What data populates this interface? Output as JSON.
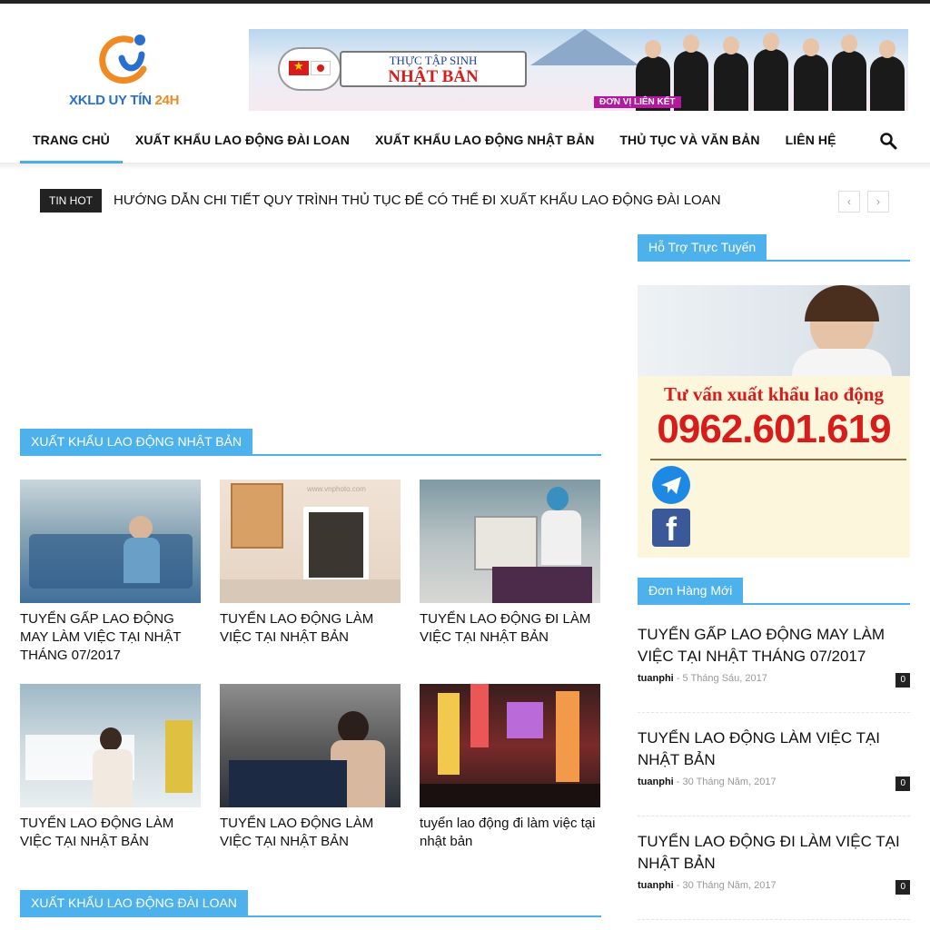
{
  "logo": {
    "text_main": "XKLD UY TÍN",
    "text_accent": "24H"
  },
  "banner": {
    "line1": "THỰC TẬP SINH",
    "line2": "NHẬT BẢN",
    "tag": "ĐƠN VỊ LIÊN KẾT"
  },
  "nav": {
    "items": [
      {
        "label": "TRANG CHỦ"
      },
      {
        "label": "XUẤT KHẨU LAO ĐỘNG ĐÀI LOAN"
      },
      {
        "label": "XUẤT KHẨU LAO ĐỘNG NHẬT BẢN"
      },
      {
        "label": "THỦ TỤC VÀ VĂN BẢN"
      },
      {
        "label": "LIÊN HỆ"
      }
    ]
  },
  "ticker": {
    "label": "TIN HOT",
    "text": "HƯỚNG DẪN CHI TIẾT QUY TRÌNH THỦ TỤC ĐỂ CÓ THỂ ĐI XUẤT KHẨU LAO ĐỘNG ĐÀI LOAN",
    "prev": "‹",
    "next": "›"
  },
  "sections": {
    "japan": "XUẤT KHẨU LAO ĐỘNG NHẬT BẢN",
    "taiwan": "XUẤT KHẨU LAO ĐỘNG ĐÀI LOAN"
  },
  "cards": [
    {
      "title": "TUYỂN GẤP LAO ĐỘNG MAY LÀM VIỆC TẠI NHẬT THÁNG 07/2017"
    },
    {
      "title": "TUYỂN LAO ĐỘNG LÀM VIỆC TẠI NHẬT BẢN",
      "watermark": "www.vnphoto.com"
    },
    {
      "title": "TUYỂN LAO ĐỘNG ĐI LÀM VIỆC TẠI NHẬT BẢN"
    },
    {
      "title": "TUYỂN LAO ĐỘNG LÀM VIỆC TẠI NHẬT BẢN"
    },
    {
      "title": "TUYỂN LAO ĐỘNG LÀM VIỆC TẠI NHẬT BẢN"
    },
    {
      "title": "tuyển lao động đi làm việc tại nhật bản"
    }
  ],
  "sidebar": {
    "support_title": "Hỗ Trợ Trực Tuyến",
    "slogan": "Tư vấn xuất khẩu lao động",
    "phone": "0962.601.619",
    "fb_letter": "f",
    "orders_title": "Đơn Hàng Mới",
    "orders": [
      {
        "title": "TUYỂN GẤP LAO ĐỘNG MAY LÀM VIỆC TẠI NHẬT THÁNG 07/2017",
        "author": "tuanphi",
        "date": "5 Tháng Sáu, 2017",
        "comments": "0"
      },
      {
        "title": "TUYỂN LAO ĐỘNG LÀM VIỆC TẠI NHẬT BẢN",
        "author": "tuanphi",
        "date": "30 Tháng Năm, 2017",
        "comments": "0"
      },
      {
        "title": "TUYỂN LAO ĐỘNG ĐI LÀM VIỆC TẠI NHẬT BẢN",
        "author": "tuanphi",
        "date": "30 Tháng Năm, 2017",
        "comments": "0"
      }
    ],
    "meta_sep": " - "
  },
  "colors": {
    "accent": "#4db2ec",
    "dark": "#222222",
    "red": "#d71c1c"
  }
}
